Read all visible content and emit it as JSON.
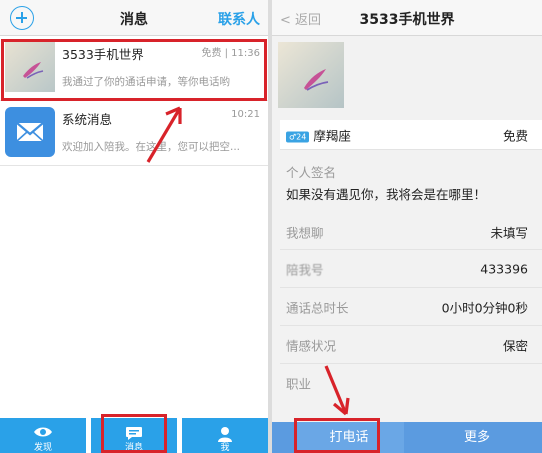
{
  "left_screen": {
    "header": {
      "title": "消息",
      "contacts_label": "联系人"
    },
    "conversations": [
      {
        "name": "3533手机世界",
        "meta": "免费 | 11:36",
        "preview": "我通过了你的通话申请，等你电话哟"
      },
      {
        "name": "系统消息",
        "meta": "10:21",
        "preview": "欢迎加入陪我。在这里，您可以把空..."
      }
    ],
    "tabs": [
      {
        "label": "发现",
        "icon": "eye-icon"
      },
      {
        "label": "消息",
        "icon": "chat-bubble-icon"
      },
      {
        "label": "我",
        "icon": "person-icon"
      }
    ]
  },
  "right_screen": {
    "header": {
      "back_label": "返回",
      "title": "3533手机世界"
    },
    "profile": {
      "gender_age": "♂24",
      "zodiac": "摩羯座",
      "price": "免费",
      "signature_label": "个人签名",
      "signature": "如果没有遇见你，我将会是在哪里！",
      "want_chat_label": "我想聊",
      "want_chat_value": "未填写",
      "id_label": "陪我号",
      "id_value": "433396",
      "call_duration_label": "通话总时长",
      "call_duration_value": "0小时0分钟0秒",
      "relationship_label": "情感状况",
      "relationship_value": "保密",
      "job_label": "职业"
    },
    "bottom": {
      "call_label": "打电话",
      "more_label": "更多"
    }
  },
  "colors": {
    "accent_blue": "#2aa1e8",
    "annotation_red": "#d8232a",
    "bottom_bar_blue": "#5b9be0"
  }
}
